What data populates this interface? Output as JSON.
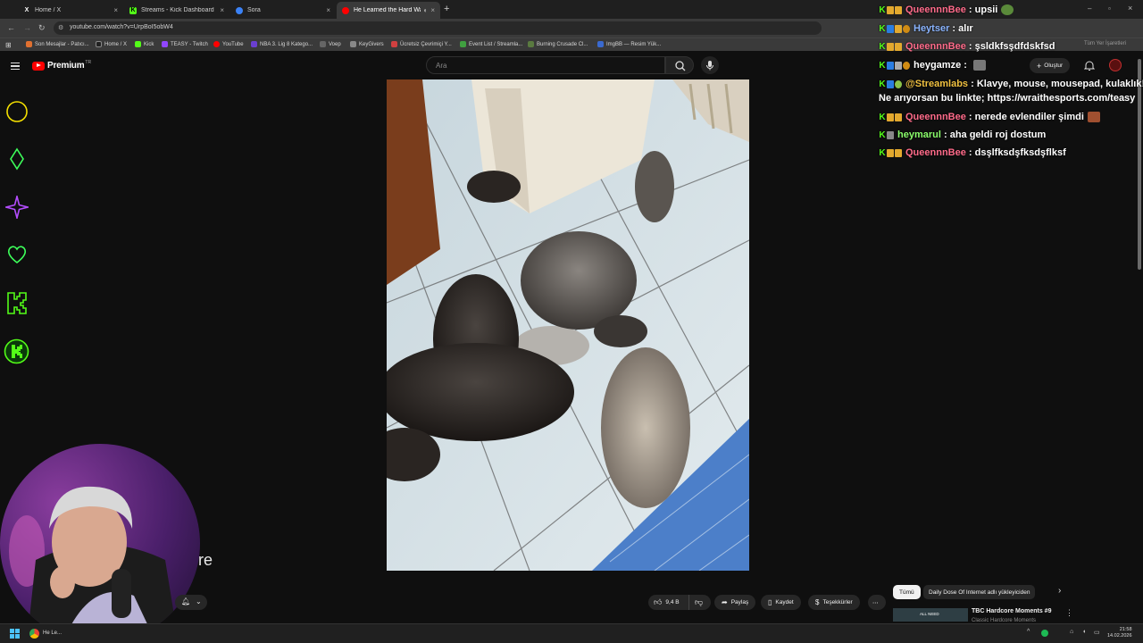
{
  "browser": {
    "tabs": [
      {
        "label": "Home / X",
        "icon": "x-logo-icon"
      },
      {
        "label": "Streams - Kick Dashboard",
        "icon": "kick-logo-icon"
      },
      {
        "label": "Sora",
        "icon": "sora-icon"
      },
      {
        "label": "He Learned the Hard Way",
        "icon": "youtube-icon"
      }
    ],
    "url": "youtube.com/watch?v=UrpBoI5obW4",
    "bookmarks": [
      "Son Mesajlar - Patıcı...",
      "Home / X",
      "Kick",
      "TEASY - Twitch",
      "YouTube",
      "NBA 3. Lig 8 Katego...",
      "Voep",
      "KeyGivers",
      "Ücretsiz Çevrimiçi Y...",
      "Event List / Streamla...",
      "Burning Crusade Cl...",
      "ImgBB — Resim Yük..."
    ],
    "bookmarks_other": "Tüm Yer İşaretleri"
  },
  "youtube": {
    "logo_text": "Premium",
    "logo_tr": "TR",
    "search_placeholder": "Ara",
    "create_label": "Oluştur",
    "actions": {
      "likes": "9,4 B",
      "share": "Paylaş",
      "save": "Kaydet",
      "thanks": "Teşekkürler"
    },
    "chips": {
      "all": "Tümü",
      "uploader": "Daily Dose Of Internet adlı yükleyiciden"
    },
    "related": {
      "title": "TBC Hardcore Moments #9",
      "channel": "Classic Hardcore Moments",
      "thumb_text": "ALL NEED"
    },
    "caption_fragment": "re"
  },
  "chat": [
    {
      "user": "QueennnBee",
      "message": "upsii",
      "user_color": "#ff6b8a"
    },
    {
      "user": "Heytser",
      "message": "alır",
      "user_color": "#8ab4ff"
    },
    {
      "user": "QueennnBee",
      "message": "şsldkfsşdfdskfsd",
      "user_color": "#ff6b8a"
    },
    {
      "user": "heygamze",
      "message": "",
      "user_color": "#ffffff"
    },
    {
      "user": "@Streamlabs",
      "message": "Klavye, mouse, mousepad, kulaklık!",
      "user_color": "#f0c040"
    },
    {
      "user": "QueennnBee",
      "message": "nerede evlendiler şimdi",
      "user_color": "#ff6b8a"
    },
    {
      "user": "heymarul",
      "message": "aha geldi roj dostum",
      "user_color": "#8bff6b"
    },
    {
      "user": "QueennnBee",
      "message": "dsşlfksdşfksdşflksf",
      "user_color": "#ff6b8a"
    }
  ],
  "chat_wrap": "Ne arıyorsan bu linkte; https://wraithesports.com/teasy",
  "taskbar": {
    "task_label": "He Le...",
    "time": "21:58",
    "date": "14.02.2026"
  },
  "colors": {
    "kick_green": "#53fc18",
    "yt_red": "#ff0000",
    "overlay_yellow": "#f5e000",
    "overlay_purple": "#b44dff"
  }
}
